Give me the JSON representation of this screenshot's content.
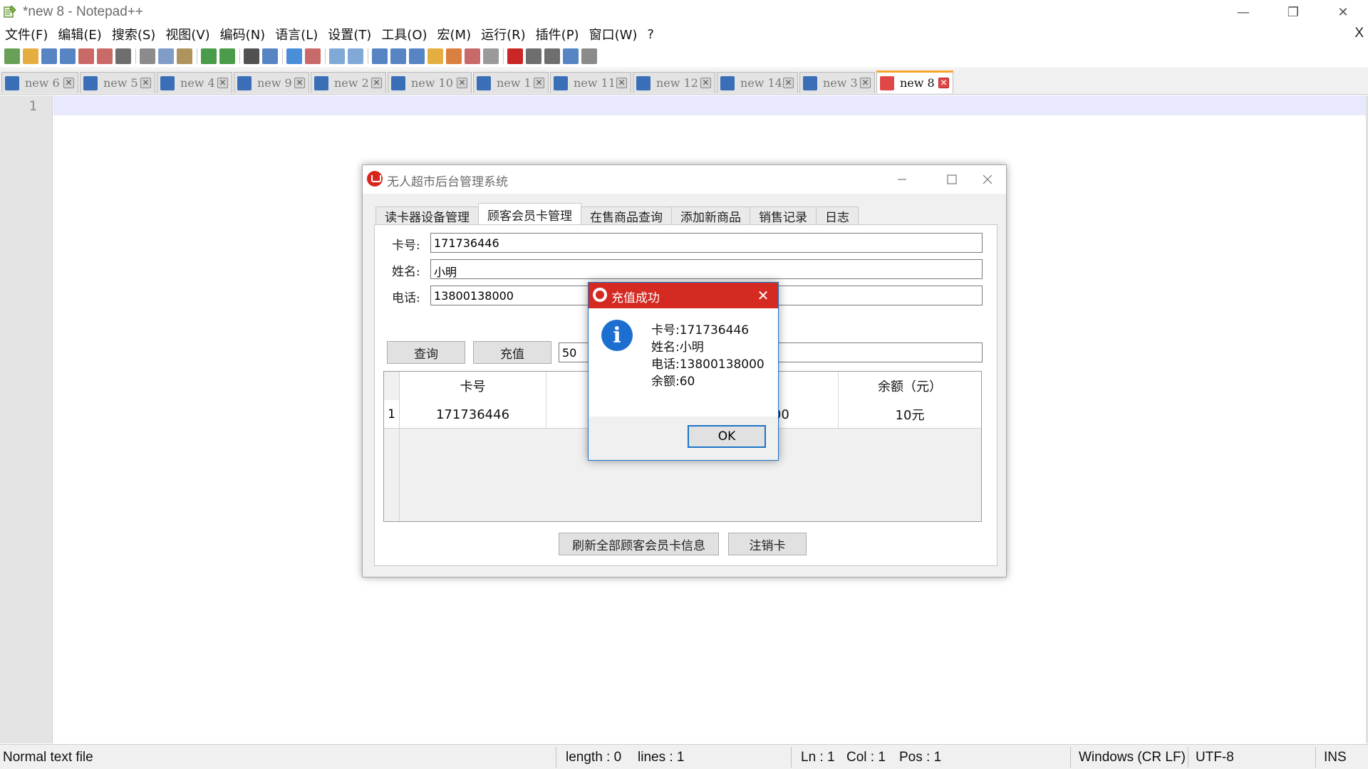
{
  "window": {
    "title": "*new 8 - Notepad++",
    "minimize_glyph": "—",
    "restore_glyph": "❐",
    "close_glyph": "✕"
  },
  "menu": {
    "items": [
      "文件(F)",
      "编辑(E)",
      "搜索(S)",
      "视图(V)",
      "编码(N)",
      "语言(L)",
      "设置(T)",
      "工具(O)",
      "宏(M)",
      "运行(R)",
      "插件(P)",
      "窗口(W)",
      "?"
    ],
    "close_doc": "X"
  },
  "toolbar": {
    "icons": [
      "new-file-icon",
      "open-file-icon",
      "save-icon",
      "save-all-icon",
      "close-icon",
      "close-all-icon",
      "print-icon",
      "cut-icon",
      "copy-icon",
      "paste-icon",
      "undo-icon",
      "redo-icon",
      "find-icon",
      "replace-icon",
      "zoom-in-icon",
      "zoom-out-icon",
      "sync-vertical-icon",
      "sync-horizontal-icon",
      "word-wrap-icon",
      "show-all-chars-icon",
      "indent-guide-icon",
      "doc-map-icon",
      "function-list-icon",
      "folder-workspace-icon",
      "monitoring-icon",
      "record-macro-icon",
      "stop-macro-icon",
      "play-macro-icon",
      "run-macro-multiple-icon",
      "save-macro-icon"
    ]
  },
  "tabs": [
    {
      "label": "new  6",
      "active": false
    },
    {
      "label": "new  5",
      "active": false
    },
    {
      "label": "new  4",
      "active": false
    },
    {
      "label": "new  9",
      "active": false
    },
    {
      "label": "new  2",
      "active": false
    },
    {
      "label": "new  10",
      "active": false
    },
    {
      "label": "new  1",
      "active": false
    },
    {
      "label": "new  11",
      "active": false
    },
    {
      "label": "new  12",
      "active": false
    },
    {
      "label": "new  14",
      "active": false
    },
    {
      "label": "new  3",
      "active": false
    },
    {
      "label": "new  8",
      "active": true
    }
  ],
  "editor": {
    "line_number": "1"
  },
  "status": {
    "file_type": "Normal text file",
    "length": "length : 0",
    "lines": "lines : 1",
    "ln": "Ln : 1",
    "col": "Col : 1",
    "pos": "Pos : 1",
    "eol": "Windows (CR LF)",
    "encoding": "UTF-8",
    "mode": "INS"
  },
  "app": {
    "title": "无人超市后台管理系统",
    "tabs": [
      "读卡器设备管理",
      "顾客会员卡管理",
      "在售商品查询",
      "添加新商品",
      "销售记录",
      "日志"
    ],
    "active_tab": 1,
    "fields": {
      "card_label": "卡号:",
      "card_value": "171736446",
      "name_label": "姓名:",
      "name_value": "小明",
      "phone_label": "电话:",
      "phone_value": "13800138000"
    },
    "query_button": "查询",
    "recharge_button": "充值",
    "recharge_amount": "50",
    "grid": {
      "headers": {
        "card": "卡号",
        "balance": "余额（元）"
      },
      "rows": [
        {
          "index": "1",
          "card": "171736446",
          "phone_partial": "3000",
          "balance": "10元"
        }
      ]
    },
    "refresh_button": "刷新全部顾客会员卡信息",
    "cancel_card_button": "注销卡",
    "brand_color": "#d42a22"
  },
  "dialog": {
    "title": "充值成功",
    "info_glyph": "i",
    "lines": [
      "卡号:171736446",
      "姓名:小明",
      "电话:13800138000",
      "余额:60"
    ],
    "ok": "OK",
    "close_glyph": "✕"
  }
}
